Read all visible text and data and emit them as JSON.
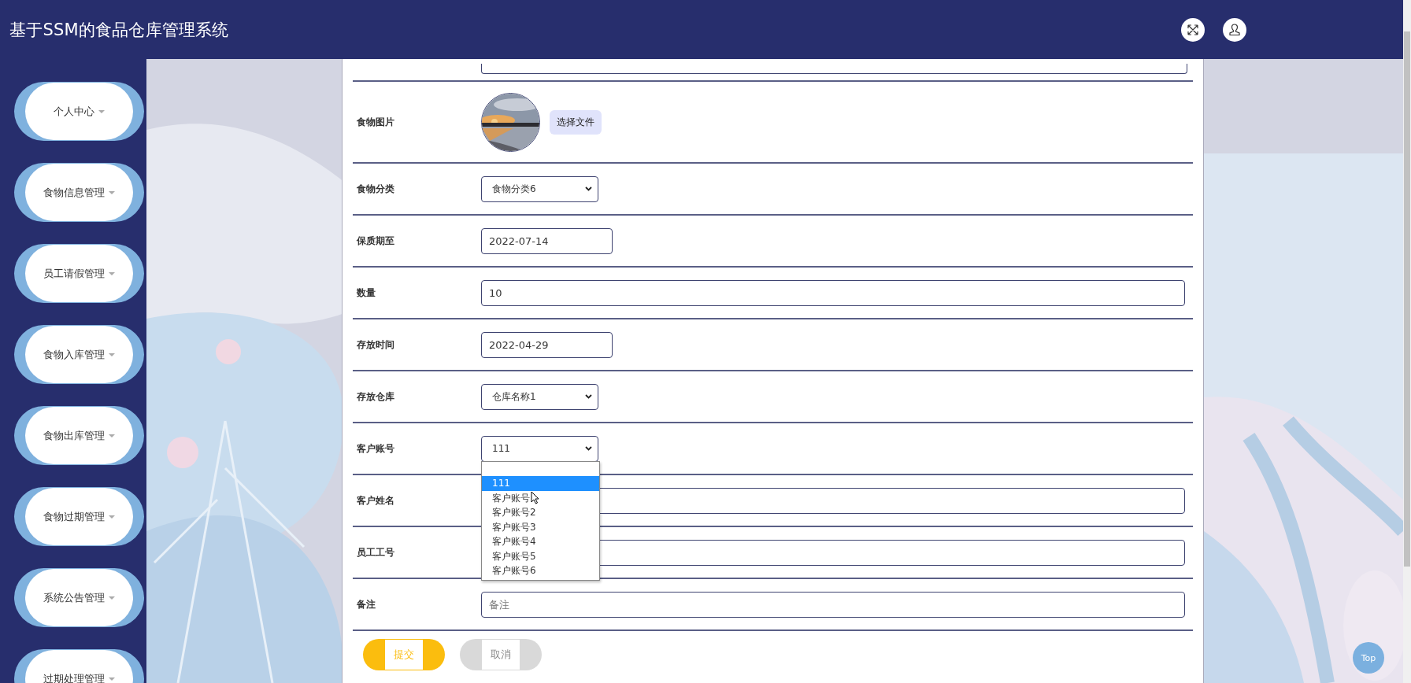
{
  "header": {
    "title": "基于SSM的食品仓库管理系统"
  },
  "sidebar": {
    "items": [
      {
        "label": "个人中心"
      },
      {
        "label": "食物信息管理"
      },
      {
        "label": "员工请假管理"
      },
      {
        "label": "食物入库管理"
      },
      {
        "label": "食物出库管理"
      },
      {
        "label": "食物过期管理"
      },
      {
        "label": "系统公告管理"
      },
      {
        "label": "过期处理管理"
      }
    ]
  },
  "form": {
    "rows": [
      {
        "label": "食物图片",
        "button": "选择文件"
      },
      {
        "kind": "select",
        "label": "食物分类",
        "value": "食物分类6"
      },
      {
        "kind": "date",
        "label": "保质期至",
        "value": "2022-07-14"
      },
      {
        "kind": "text",
        "label": "数量",
        "value": "10"
      },
      {
        "kind": "date",
        "label": "存放时间",
        "value": "2022-04-29"
      },
      {
        "kind": "select",
        "label": "存放仓库",
        "value": "仓库名称1"
      },
      {
        "kind": "select",
        "label": "客户账号",
        "value": "111",
        "expanded": true,
        "options": [
          {
            "label": "111",
            "selected": true
          },
          {
            "label": "客户账号",
            "selected": false
          },
          {
            "label": "客户账号2",
            "selected": false
          },
          {
            "label": "客户账号3",
            "selected": false
          },
          {
            "label": "客户账号4",
            "selected": false
          },
          {
            "label": "客户账号5",
            "selected": false
          },
          {
            "label": "客户账号6",
            "selected": false
          }
        ]
      },
      {
        "kind": "text",
        "label": "客户姓名"
      },
      {
        "kind": "text",
        "label": "员工工号"
      },
      {
        "kind": "text",
        "label": "备注",
        "placeholder": "备注"
      }
    ],
    "buttons": [
      {
        "label": "提交",
        "kind": "primary"
      },
      {
        "label": "取消",
        "kind": "secondary"
      }
    ]
  },
  "top_button": "Top"
}
